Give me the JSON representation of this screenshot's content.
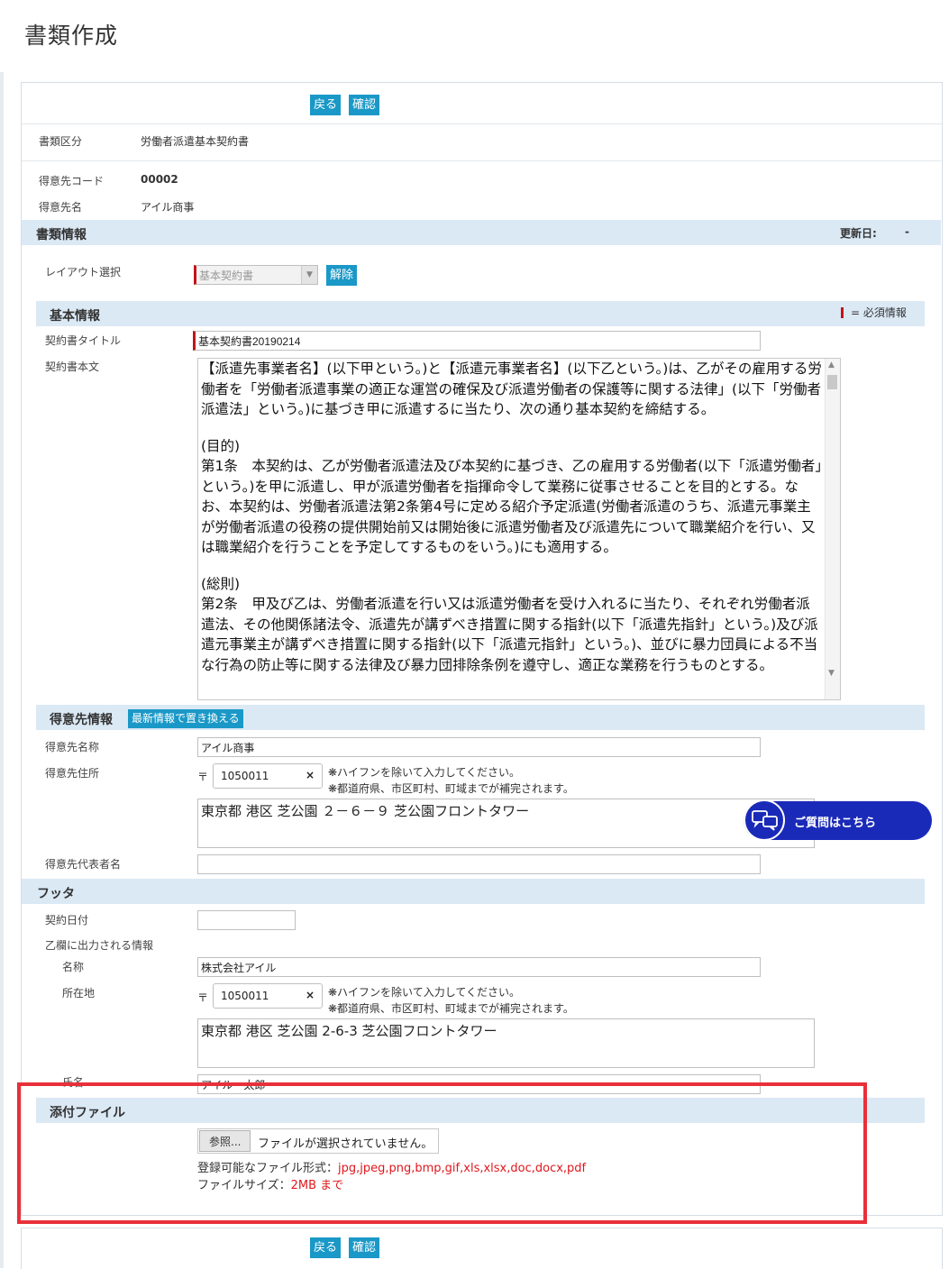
{
  "page_title": "書類作成",
  "actions": {
    "back_label": "戻る",
    "confirm_label": "確認"
  },
  "header_info": {
    "doc_type_label": "書類区分",
    "doc_type_value": "労働者派遣基本契約書",
    "customer_code_label": "得意先コード",
    "customer_code_value": "00002",
    "customer_name_label": "得意先名",
    "customer_name_value": "アイル商事"
  },
  "doc_info": {
    "title": "書類情報",
    "updated_label": "更新日:",
    "updated_value": "-",
    "layout_label": "レイアウト選択",
    "layout_value": "基本契約書",
    "release_label": "解除"
  },
  "basic_info": {
    "title": "基本情報",
    "required_legend": "= 必須情報",
    "contract_title_label": "契約書タイトル",
    "contract_title_value": "基本契約書20190214",
    "contract_body_label": "契約書本文",
    "body_para1": "【派遣先事業者名】(以下甲という。)と【派遣元事業者名】(以下乙という。)は、乙がその雇用する労働者を「労働者派遣事業の適正な運営の確保及び派遣労働者の保護等に関する法律」(以下「労働者派遣法」という。)に基づき甲に派遣するに当たり、次の通り基本契約を締結する。",
    "body_head2": "(目的)",
    "body_para2": "第1条　本契約は、乙が労働者派遣法及び本契約に基づき、乙の雇用する労働者(以下「派遣労働者」という。)を甲に派遣し、甲が派遣労働者を指揮命令して業務に従事させることを目的とする。なお、本契約は、労働者派遣法第2条第4号に定める紹介予定派遣(労働者派遣のうち、派遣元事業主が労働者派遣の役務の提供開始前又は開始後に派遣労働者及び派遣先について職業紹介を行い、又は職業紹介を行うことを予定してするものをいう。)にも適用する。",
    "body_head3": "(総則)",
    "body_para3": "第2条　甲及び乙は、労働者派遣を行い又は派遣労働者を受け入れるに当たり、それぞれ労働者派遣法、その他関係諸法令、派遣先が講ずべき措置に関する指針(以下「派遣先指針」という。)及び派遣元事業主が講ずべき措置に関する指針(以下「派遣元指針」という。)、並びに暴力団員による不当な行為の防止等に関する法律及び暴力団排除条例を遵守し、適正な業務を行うものとする。"
  },
  "customer_info": {
    "title": "得意先情報",
    "refresh_label": "最新情報で置き換える",
    "name_label": "得意先名称",
    "name_value": "アイル商事",
    "address_label": "得意先住所",
    "zip_mark": "〒",
    "zip_value": "1050011",
    "clear_glyph": "×",
    "note1": "❋ハイフンを除いて入力してください。",
    "note2": "❋都道府県、市区町村、町域までが補完されます。",
    "address_value": "東京都 港区 芝公園 ２－６－９ 芝公園フロントタワー",
    "rep_label": "得意先代表者名",
    "rep_value": ""
  },
  "footer": {
    "title": "フッタ",
    "date_label": "契約日付",
    "date_value": "",
    "b_info_label": "乙欄に出力される情報",
    "company_label": "名称",
    "company_value": "株式会社アイル",
    "location_label": "所在地",
    "zip_mark": "〒",
    "zip_value": "1050011",
    "clear_glyph": "×",
    "note1": "❋ハイフンを除いて入力してください。",
    "note2": "❋都道府県、市区町村、町域までが補完されます。",
    "address_value": "東京都 港区 芝公園 2-6-3 芝公園フロントタワー",
    "person_label": "氏名",
    "person_value": "アイル　太郎"
  },
  "attachment": {
    "title": "添付ファイル",
    "browse_label": "参照...",
    "no_file_label": "ファイルが選択されていません。",
    "formats_label": "登録可能なファイル形式：",
    "formats_value": "jpg,jpeg,png,bmp,gif,xls,xlsx,doc,docx,pdf",
    "size_label": "ファイルサイズ：",
    "size_value": "2MB  まで"
  },
  "chat": {
    "label": "ご質問はこちら",
    "icon": "chat-bubbles-icon"
  },
  "colors": {
    "button": "#1a98c7",
    "section_bg": "#dbe9f5",
    "required": "#c1141b",
    "highlight": "#e8303a",
    "chat": "#1a2ab8",
    "note_red": "#e0171c"
  }
}
